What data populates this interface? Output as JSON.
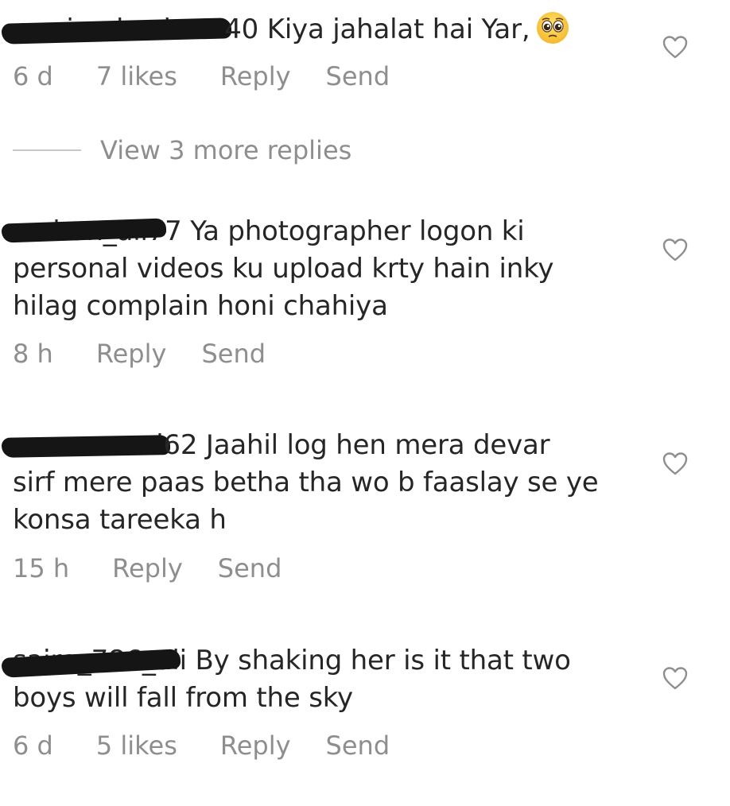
{
  "comments": [
    {
      "username": "mariambasheer40",
      "username_visible_tail": "40",
      "text": "Kiya jahalat hai Yar,",
      "emoji": "pleading-face-emoji",
      "time": "6 d",
      "likes": "7 likes",
      "reply": "Reply",
      "send": "Send"
    },
    {
      "username": "mshan_ali77",
      "username_visible_tail": "7",
      "text": "Ya photographer logon ki personal videos ku upload krty hain inky hilag complain honi chahiya",
      "line1": "Ya photographer logon ki",
      "line2": "personal videos ku upload krty hain inky",
      "line3": "hilag complain honi chahiya",
      "time": "8 h",
      "reply": "Reply",
      "send": "Send"
    },
    {
      "username": "noorsamad62",
      "username_visible_tail": "62",
      "text": "Jaahil log hen mera devar sirf mere paas betha tha wo b faaslay se ye konsa tareeka h",
      "line1": "Jaahil log hen mera devar",
      "line2": "sirf mere paas betha tha wo b faaslay se ye",
      "line3": "konsa tareeka h",
      "time": "15 h",
      "reply": "Reply",
      "send": "Send"
    },
    {
      "username": "saira_786_ali",
      "username_visible_tail": "i",
      "text": "By shaking her is it that two boys will fall from the sky",
      "line1": "By shaking her is it that two",
      "line2": "boys will fall from the sky",
      "time": "6 d",
      "likes": "5 likes",
      "reply": "Reply",
      "send": "Send"
    }
  ],
  "view_replies": {
    "label": "View 3 more replies"
  },
  "icons": {
    "like": "heart-outline-icon"
  },
  "colors": {
    "text": "#262626",
    "meta": "#8e8e8e",
    "redaction": "#151515",
    "divider": "#c7c7c7"
  }
}
